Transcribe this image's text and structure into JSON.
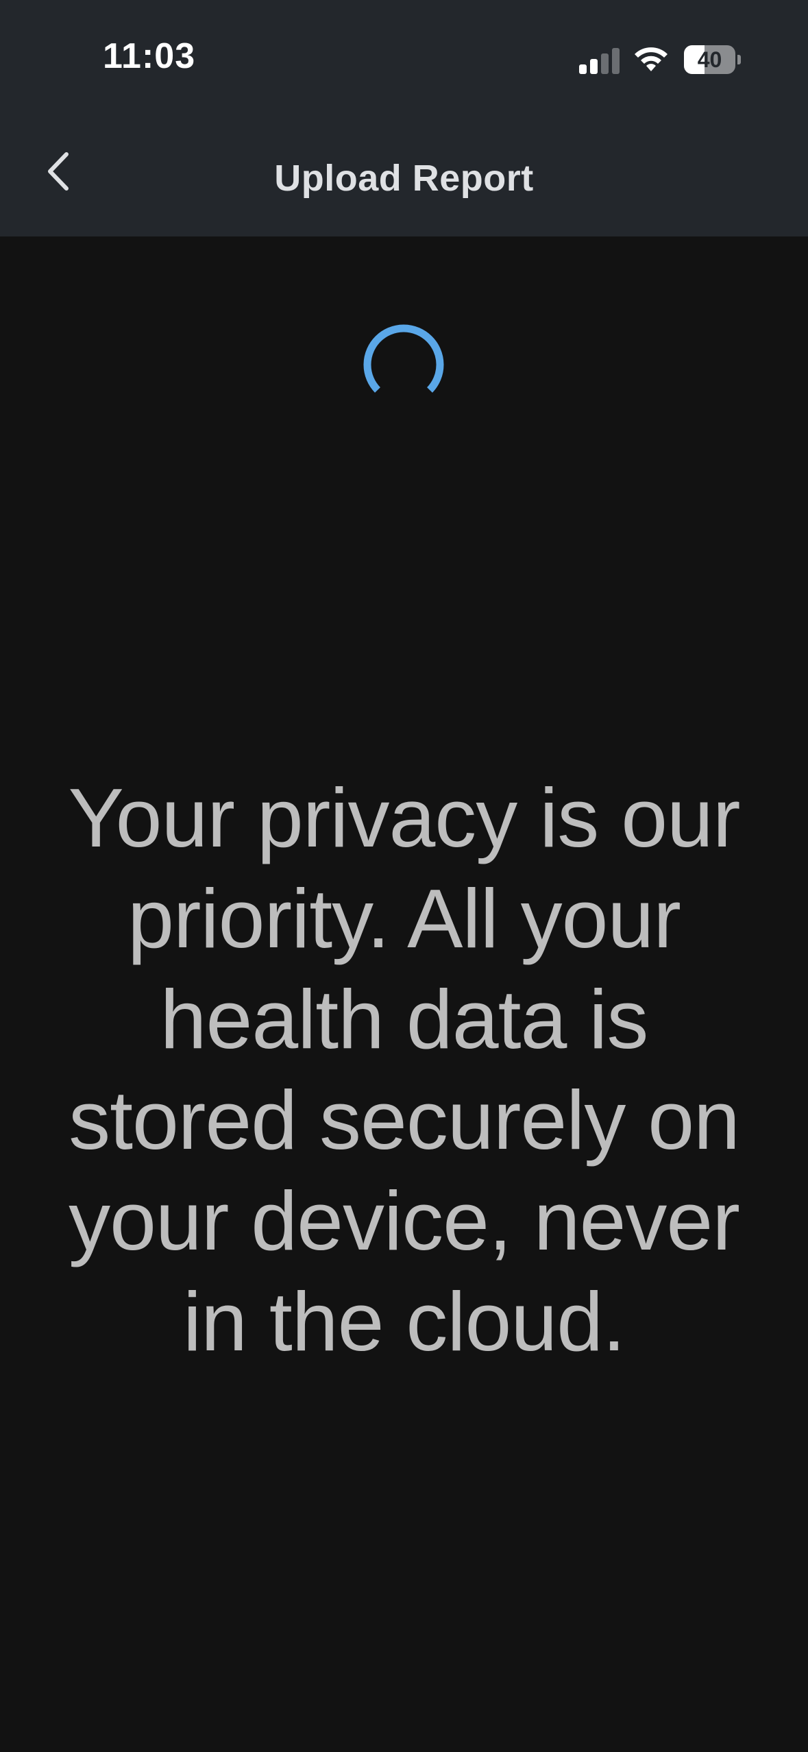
{
  "status_bar": {
    "time": "11:03",
    "battery_level": "40",
    "battery_fraction": 0.4,
    "signal_bars_active": 2,
    "signal_bars_total": 4,
    "icons": [
      "signal-icon",
      "wifi-icon",
      "battery-icon"
    ]
  },
  "nav": {
    "title": "Upload Report",
    "back_icon": "chevron-left-icon"
  },
  "content": {
    "loading_icon": "spinner-icon",
    "accent_color": "#5aa7e8",
    "message": "Your privacy is our priority. All your health data is stored securely on your device, never in the cloud."
  },
  "colors": {
    "header_background": "#23272c",
    "page_background": "#121212",
    "message_text": "#bdbdbd"
  }
}
